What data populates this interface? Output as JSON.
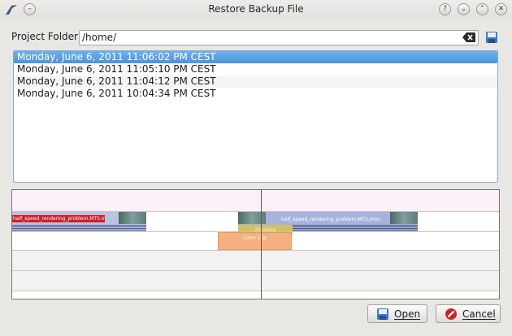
{
  "window": {
    "title": "Restore Backup File",
    "controls": {
      "help": "?",
      "minimize": "⌄",
      "maximize": "⌃",
      "close": "✕"
    }
  },
  "project_folder": {
    "label": "Project Folder",
    "value": "/home/"
  },
  "backups": {
    "items": [
      "Monday, June 6, 2011 11:06:02 PM CEST",
      "Monday, June 6, 2011 11:05:10 PM CEST",
      "Monday, June 6, 2011 11:04:12 PM CEST",
      "Monday, June 6, 2011 10:04:34 PM CEST"
    ],
    "selected_index": 0
  },
  "timeline": {
    "clip1_name": "half_speed_rendering_problem.MTS.mov",
    "clip2_name": "half_speed_rendering_problem.MTS.mov",
    "transition_label": "Dissolve",
    "color_clip_label": "Color Clip"
  },
  "buttons": {
    "open": "Open",
    "cancel": "Cancel"
  },
  "colors": {
    "selection": "#4a93dc",
    "clip_red": "#d41d2a",
    "clip_blue": "#a7b3de",
    "transition": "#d9c75c",
    "color_clip": "#f5b080"
  }
}
